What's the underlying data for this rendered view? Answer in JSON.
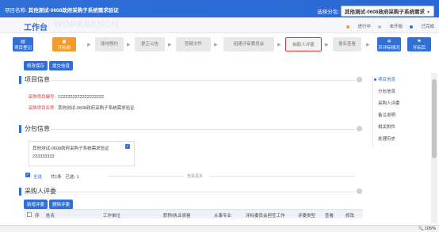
{
  "topbar": {
    "project_label": "项目名称:",
    "project_name": "其他测试-0608政府采购子系统需求验证",
    "package_label": "选择分包:",
    "package_value": "其他测试-0608政府采购子系统需求"
  },
  "workspace": {
    "title": "工作台",
    "watermark": "WORKBENCH"
  },
  "legend": {
    "items": [
      {
        "label": "进行中",
        "color": "#f39c2c"
      },
      {
        "label": "未开始",
        "color": "#b5bbc5"
      },
      {
        "label": "已完成",
        "color": "#2f6fd6"
      }
    ]
  },
  "flow": {
    "steps": [
      {
        "label": "项目登记",
        "state": "blue"
      },
      {
        "label": "开标前",
        "state": "orange"
      },
      {
        "label": "场地预约",
        "state": "gray"
      },
      {
        "label": "更正公告",
        "state": "gray"
      },
      {
        "label": "答疑文件",
        "state": "gray"
      },
      {
        "label": "组建评审委员会",
        "state": "gray"
      },
      {
        "label": "抽取人评委",
        "state": "highlight"
      },
      {
        "label": "报名查看",
        "state": "gray"
      },
      {
        "label": "开评标情况",
        "state": "blue"
      },
      {
        "label": "开标后",
        "state": "blue"
      }
    ]
  },
  "buttons": {
    "save": "修改保存",
    "submit": "提交信息"
  },
  "project_info": {
    "title": "项目信息",
    "code_label": "采购项目编号:",
    "code_value": "1222222222222222222",
    "name_label": "采购项目名称:",
    "name_value": "其他测试-0608政府采购子系统需求验证"
  },
  "package_info": {
    "title": "分包信息",
    "card_name": "其他测试-0608政府采购子系统需求验证",
    "card_code": "233333333",
    "select_all": "全选",
    "total": "共1条",
    "selected_label": "已选:",
    "selected_count": "1",
    "more": "查看更多"
  },
  "reviewers": {
    "title": "采购人评委",
    "add": "新增评委",
    "delete": "删除评委",
    "columns": [
      "序",
      "姓名",
      "工作单位",
      "职称/执业资格",
      "从事专业",
      "评标委员会担任工作",
      "评委类型",
      "查看",
      "修改"
    ]
  },
  "sidenav": {
    "items": [
      {
        "label": "项目信息",
        "active": true
      },
      {
        "label": "分包信息",
        "active": false
      },
      {
        "label": "采购人评委",
        "active": false
      },
      {
        "label": "备注说明",
        "active": false
      },
      {
        "label": "相关附件",
        "active": false
      },
      {
        "label": "处理历史",
        "active": false
      }
    ]
  },
  "status": {
    "zoom": "105%"
  }
}
